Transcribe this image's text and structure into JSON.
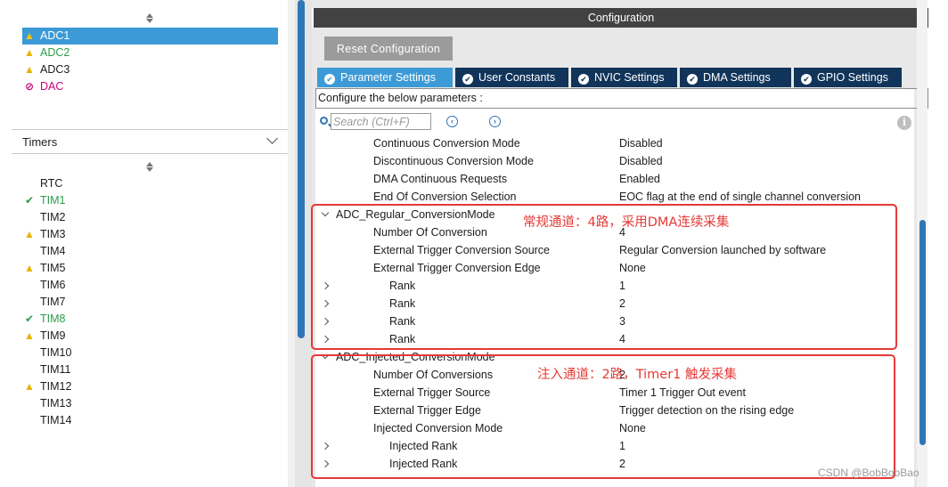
{
  "left_panel": {
    "analog_items": [
      {
        "label": "ADC1",
        "status": "warning",
        "selected": true
      },
      {
        "label": "ADC2",
        "status": "warning",
        "selected": false
      },
      {
        "label": "ADC3",
        "status": "warning",
        "selected": false
      },
      {
        "label": "DAC",
        "status": "disabled",
        "selected": false
      }
    ],
    "timers_title": "Timers",
    "timer_items": [
      {
        "label": "RTC",
        "status": "none"
      },
      {
        "label": "TIM1",
        "status": "ok"
      },
      {
        "label": "TIM2",
        "status": "none"
      },
      {
        "label": "TIM3",
        "status": "warning"
      },
      {
        "label": "TIM4",
        "status": "none"
      },
      {
        "label": "TIM5",
        "status": "warning"
      },
      {
        "label": "TIM6",
        "status": "none"
      },
      {
        "label": "TIM7",
        "status": "none"
      },
      {
        "label": "TIM8",
        "status": "ok"
      },
      {
        "label": "TIM9",
        "status": "warning"
      },
      {
        "label": "TIM10",
        "status": "none"
      },
      {
        "label": "TIM11",
        "status": "none"
      },
      {
        "label": "TIM12",
        "status": "warning"
      },
      {
        "label": "TIM13",
        "status": "none"
      },
      {
        "label": "TIM14",
        "status": "none"
      }
    ]
  },
  "config": {
    "title": "Configuration",
    "reset_label": "Reset Configuration",
    "tabs": [
      {
        "label": "Parameter Settings",
        "active": true
      },
      {
        "label": "User Constants",
        "active": false
      },
      {
        "label": "NVIC Settings",
        "active": false
      },
      {
        "label": "DMA Settings",
        "active": false
      },
      {
        "label": "GPIO Settings",
        "active": false
      }
    ],
    "params_header": "Configure the below parameters :",
    "search_placeholder": "Search (Ctrl+F)",
    "rows": [
      {
        "name": "Continuous Conversion Mode",
        "value": "Disabled",
        "level": "param",
        "chevron": ""
      },
      {
        "name": "Discontinuous Conversion Mode",
        "value": "Disabled",
        "level": "param",
        "chevron": ""
      },
      {
        "name": "DMA Continuous Requests",
        "value": "Enabled",
        "level": "param",
        "chevron": ""
      },
      {
        "name": "End Of Conversion Selection",
        "value": "EOC flag at the end of single channel conversion",
        "level": "param",
        "chevron": ""
      },
      {
        "name": "ADC_Regular_ConversionMode",
        "value": "",
        "level": "group",
        "chevron": "down"
      },
      {
        "name": "Number Of Conversion",
        "value": "4",
        "level": "param",
        "chevron": ""
      },
      {
        "name": "External Trigger Conversion Source",
        "value": "Regular Conversion launched by software",
        "level": "param",
        "chevron": ""
      },
      {
        "name": "External Trigger Conversion Edge",
        "value": "None",
        "level": "param",
        "chevron": ""
      },
      {
        "name": "Rank",
        "value": "1",
        "level": "deep",
        "chevron": "right"
      },
      {
        "name": "Rank",
        "value": "2",
        "level": "deep",
        "chevron": "right"
      },
      {
        "name": "Rank",
        "value": "3",
        "level": "deep",
        "chevron": "right"
      },
      {
        "name": "Rank",
        "value": "4",
        "level": "deep",
        "chevron": "right"
      },
      {
        "name": "ADC_Injected_ConversionMode",
        "value": "",
        "level": "group",
        "chevron": "down"
      },
      {
        "name": "Number Of Conversions",
        "value": "2",
        "level": "param",
        "chevron": ""
      },
      {
        "name": "External Trigger Source",
        "value": "Timer 1 Trigger Out event",
        "level": "param",
        "chevron": ""
      },
      {
        "name": "External Trigger Edge",
        "value": "Trigger detection on the rising edge",
        "level": "param",
        "chevron": ""
      },
      {
        "name": "Injected Conversion Mode",
        "value": "None",
        "level": "param",
        "chevron": ""
      },
      {
        "name": "Injected Rank",
        "value": "1",
        "level": "deep",
        "chevron": "right"
      },
      {
        "name": "Injected Rank",
        "value": "2",
        "level": "deep",
        "chevron": "right"
      }
    ]
  },
  "annotations": {
    "regular": "常规通道：4路，采用DMA连续采集",
    "injected": "注入通道：2路，Timer1 触发采集"
  },
  "watermark": "CSDN @BobBobBao",
  "colors": {
    "selected": "#3c9ad6",
    "tab_dark": "#11355a",
    "warning": "#e8b400",
    "ok": "#2a9d4a",
    "disabled": "#c8007a",
    "annotation": "#e53935"
  }
}
